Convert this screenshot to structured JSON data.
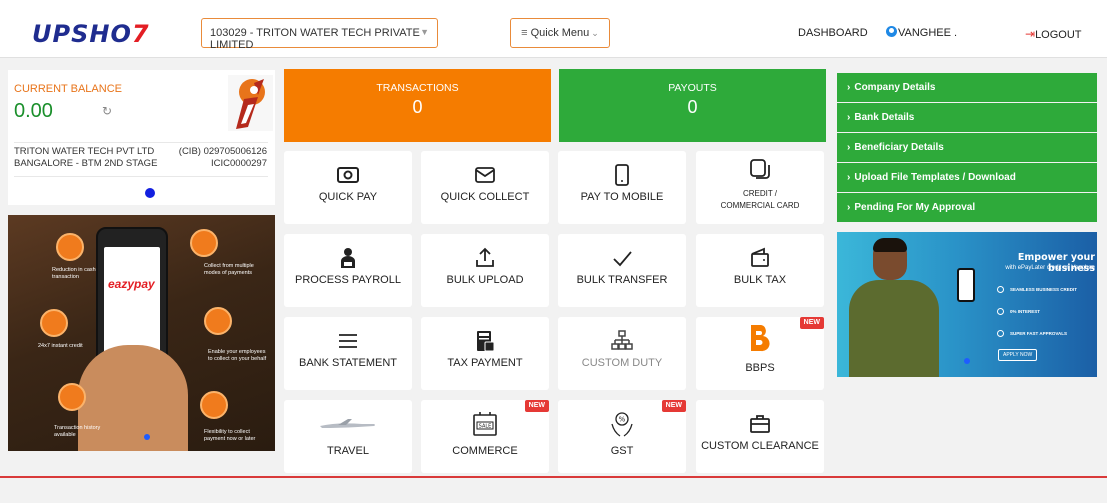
{
  "header": {
    "logo_text_main": "UPSHO",
    "logo_text_accent": "7",
    "account_select_value": "103029 - TRITON WATER TECH PRIVATE LIMITED",
    "quick_menu_label": "Quick Menu",
    "nav_dashboard": "DASHBOARD",
    "nav_user": "VANGHEE .",
    "nav_logout": "LOGOUT"
  },
  "balance": {
    "label": "CURRENT BALANCE",
    "value": "0.00",
    "account_name": "TRITON WATER TECH PVT LTD",
    "account_number": "(CIB) 029705006126",
    "branch": "BANGALORE - BTM 2ND STAGE",
    "ifsc": "ICIC0000297"
  },
  "stats": {
    "transactions_label": "TRANSACTIONS",
    "transactions_value": "0",
    "payouts_label": "PAYOUTS",
    "payouts_value": "0"
  },
  "tiles": {
    "quick_pay": "QUICK PAY",
    "quick_collect": "QUICK COLLECT",
    "pay_to_mobile": "PAY TO MOBILE",
    "credit_card_line1": "CREDIT /",
    "credit_card_line2": "COMMERCIAL CARD",
    "process_payroll": "PROCESS PAYROLL",
    "bulk_upload": "BULK UPLOAD",
    "bulk_transfer": "BULK TRANSFER",
    "bulk_tax": "BULK TAX",
    "bank_statement": "BANK STATEMENT",
    "tax_payment": "TAX PAYMENT",
    "custom_duty": "CUSTOM DUTY",
    "bbps": "BBPS",
    "travel": "TRAVEL",
    "commerce": "COMMERCE",
    "gst": "GST",
    "custom_clearance": "CUSTOM CLEARANCE",
    "new_badge": "NEW"
  },
  "side_menu": {
    "items": [
      "Company Details",
      "Bank Details",
      "Beneficiary Details",
      "Upload File Templates / Download",
      "Pending For My Approval"
    ]
  },
  "promo_left": {
    "brand": "eazypay",
    "captions": [
      "Reduction in cash transaction",
      "Collect from multiple modes of payments",
      "24x7 instant credit",
      "Enable your employees to collect on your behalf",
      "Transaction history available",
      "Flexibility to collect payment now or later"
    ]
  },
  "promo_right": {
    "title": "Empower your business",
    "subtitle": "with ePayLater credit on Vanghee",
    "features": [
      "SEAMLESS BUSINESS CREDIT",
      "0% INTEREST",
      "SUPER FAST APPROVALS"
    ],
    "cta": "APPLY NOW"
  },
  "colors": {
    "orange": "#f57c00",
    "green": "#2eaa3a",
    "brand_blue": "#1f2c8f",
    "brand_red": "#e31e24"
  }
}
